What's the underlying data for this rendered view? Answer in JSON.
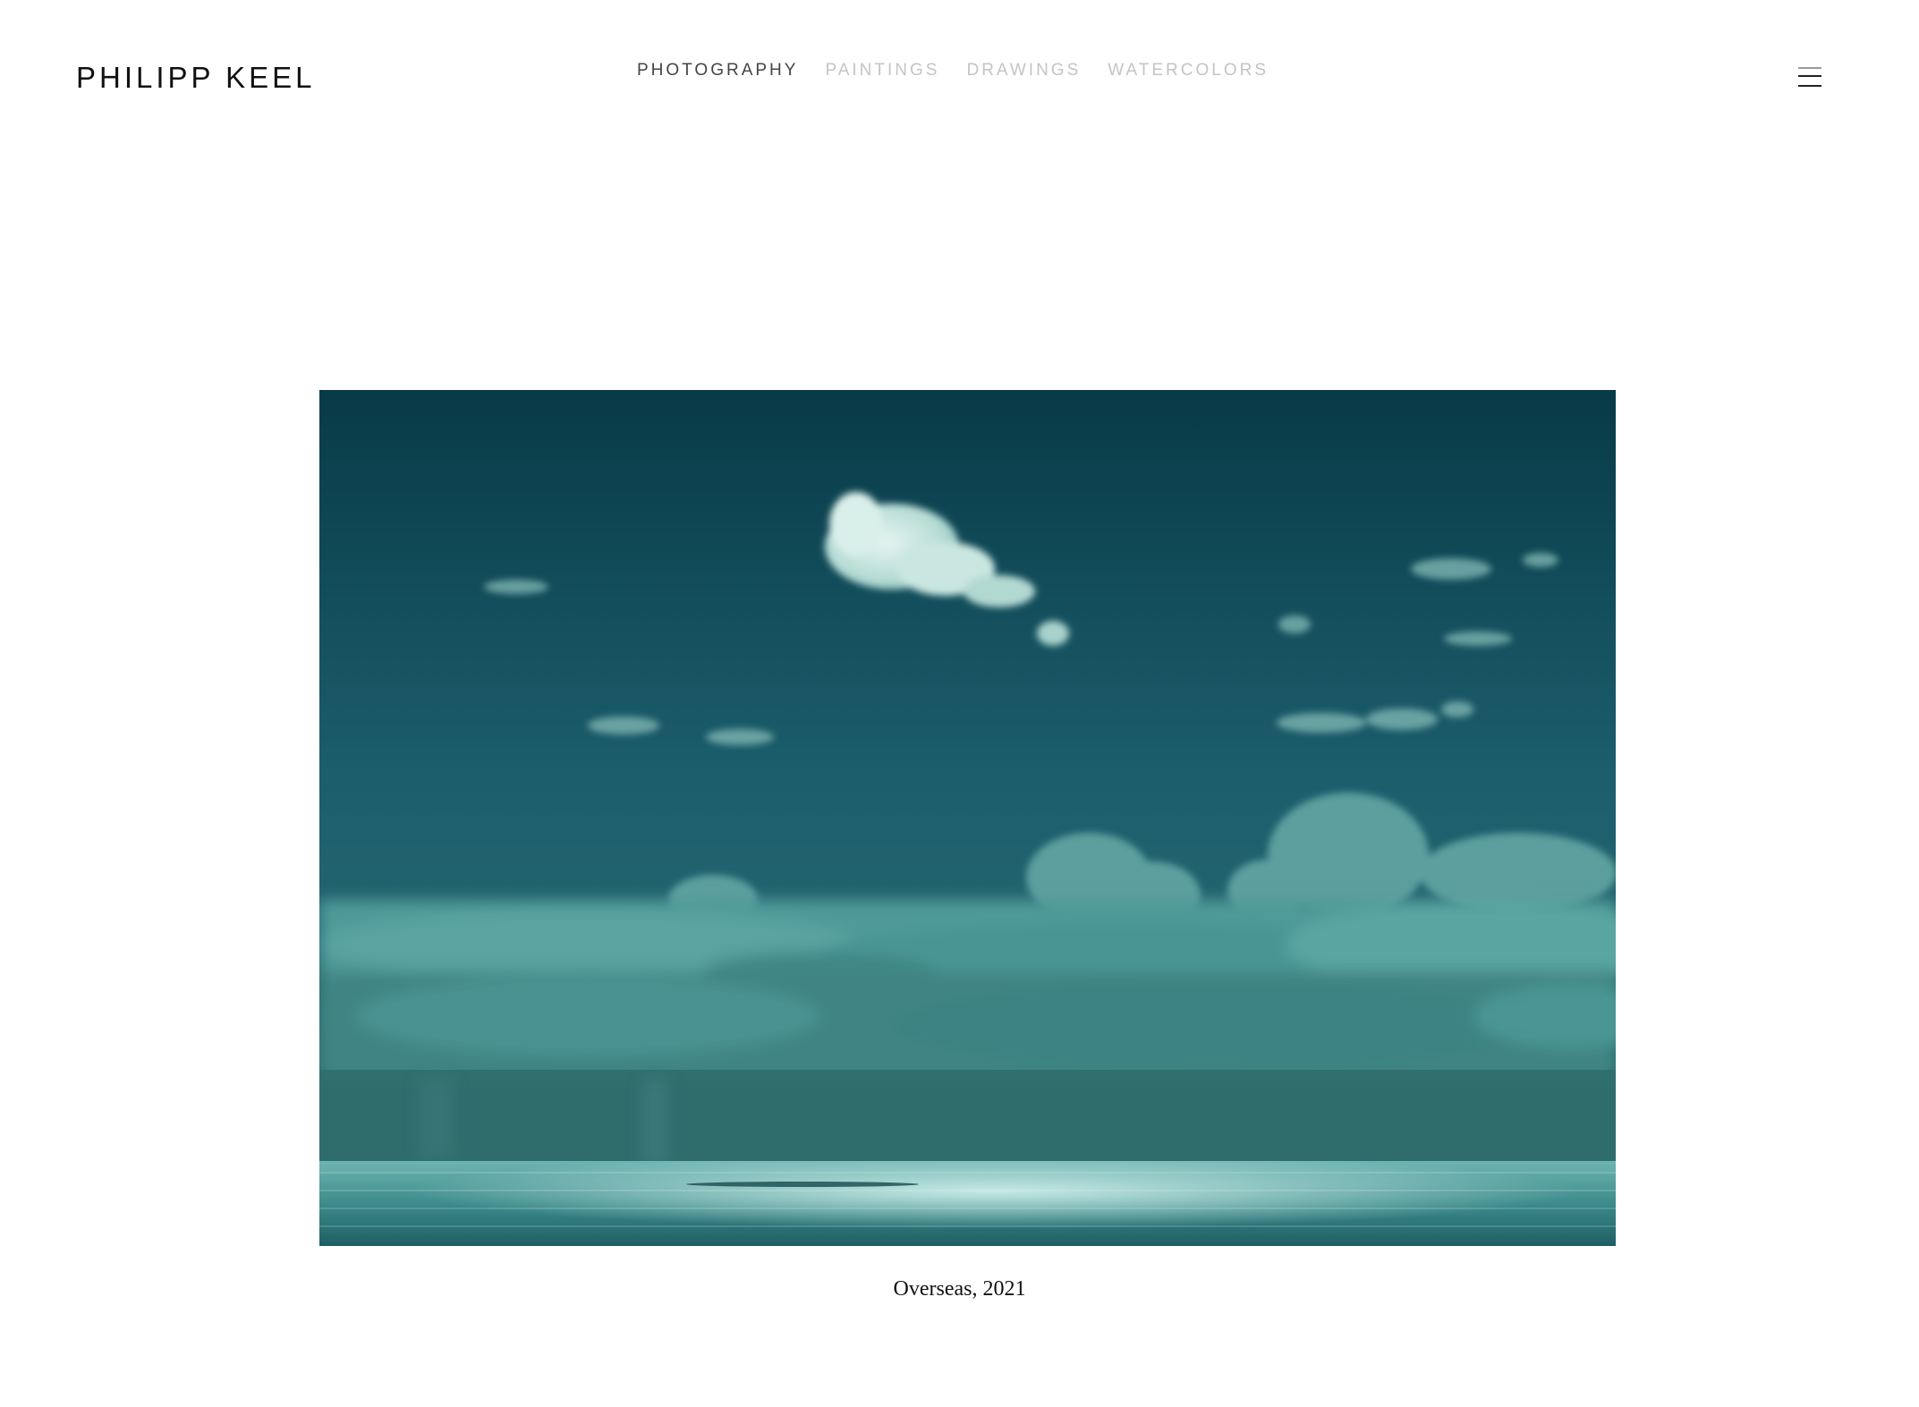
{
  "site": {
    "logo": "PHILIPP KEEL"
  },
  "nav": {
    "items": [
      {
        "label": "PHOTOGRAPHY",
        "active": true
      },
      {
        "label": "PAINTINGS",
        "active": false
      },
      {
        "label": "DRAWINGS",
        "active": false
      },
      {
        "label": "WATERCOLORS",
        "active": false
      }
    ]
  },
  "menu": {
    "icon": "hamburger-menu-icon"
  },
  "artwork": {
    "caption": "Overseas, 2021",
    "palette": {
      "sky_top": "#083a47",
      "sky_mid": "#1c5e6c",
      "cloud_bank": "#4f9a99",
      "cloud_highlight": "#cfe9e4",
      "sea": "#2e7f82",
      "sea_shimmer": "#a8dcd7"
    }
  }
}
